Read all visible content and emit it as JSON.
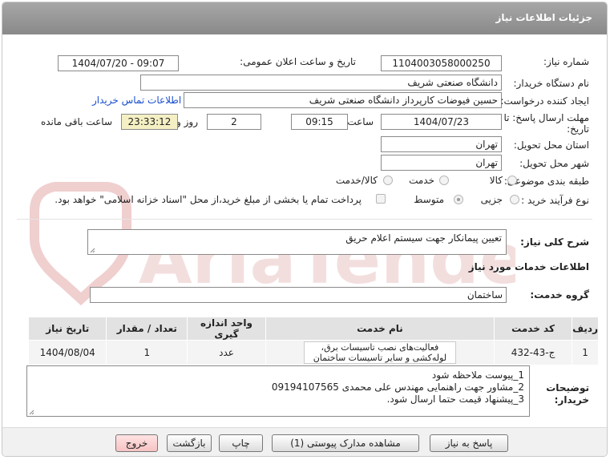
{
  "header": {
    "title": "جزئیات اطلاعات نیاز"
  },
  "watermark": {
    "text": "AriaTender.net",
    "color": "#efc8c8"
  },
  "colors": {
    "header": "#999999",
    "highlight_field": "#f5f0c4",
    "link": "#1a4fd0",
    "exit_button": "#f6c3c3"
  },
  "form": {
    "need_number": {
      "label": "شماره نیاز:",
      "value": "1104003058000250"
    },
    "announce_datetime": {
      "label": "تاریخ و ساعت اعلان عمومی:",
      "value": "1404/07/20 - 09:07"
    },
    "buyer_org": {
      "label": "نام دستگاه خریدار:",
      "value": "دانشگاه صنعتی شریف"
    },
    "requester": {
      "label": "ایجاد کننده درخواست:",
      "value": "حسین فیوضات کارپرداز دانشگاه صنعتی شریف",
      "contact_link": "اطلاعات تماس خریدار"
    },
    "deadline": {
      "label_line1": "مهلت ارسال پاسخ: تا",
      "label_line2": "تاریخ:",
      "date": "1404/07/23",
      "time_label": "ساعت",
      "time": "09:15",
      "days": "2",
      "days_label": "روز و",
      "remaining": "23:33:12",
      "remaining_label": "ساعت باقی مانده"
    },
    "province": {
      "label": "استان محل تحویل:",
      "value": "تهران"
    },
    "city": {
      "label": "شهر محل تحویل:",
      "value": "تهران"
    },
    "category": {
      "label": "طبقه بندی موضوعی:",
      "options": [
        "کالا",
        "خدمت",
        "کالا/خدمت"
      ],
      "selected": "none"
    },
    "process": {
      "label": "نوع فرآیند خرید :",
      "options": [
        "جزیی",
        "متوسط"
      ],
      "selected": "متوسط",
      "payment_note": "پرداخت تمام یا بخشی از مبلغ خرید،از محل \"اسناد خزانه اسلامی\" خواهد بود."
    }
  },
  "summary": {
    "label": "شرح کلی نیاز:",
    "value": "تعیین پیمانکار جهت سیستم اعلام حریق"
  },
  "services_title": "اطلاعات خدمات مورد نیاز",
  "service_group": {
    "label": "گروه خدمت:",
    "value": "ساختمان"
  },
  "table": {
    "headers": [
      "ردیف",
      "کد خدمت",
      "نام خدمت",
      "واحد اندازه گیری",
      "تعداد / مقدار",
      "تاریخ نیاز"
    ],
    "rows": [
      {
        "row": "1",
        "code": "ج-43-432",
        "name": "فعالیت‌های نصب تاسیسات برق، لوله‌کشی و سایر تاسیسات ساختمان",
        "unit": "عدد",
        "qty": "1",
        "date": "1404/08/04"
      }
    ]
  },
  "notes": {
    "label_line1": "توضیحات",
    "label_line2": "خریدار:",
    "lines": [
      "1_پیوست ملاحظه شود",
      "2_مشاور جهت راهنمایی مهندس علی محمدی 09194107565",
      "3_پیشنهاد قیمت حتما ارسال شود."
    ]
  },
  "buttons": {
    "reply": "پاسخ به نیاز",
    "attachments": "مشاهده مدارک پیوستی (1)",
    "print": "چاپ",
    "back": "بازگشت",
    "exit": "خروج"
  }
}
